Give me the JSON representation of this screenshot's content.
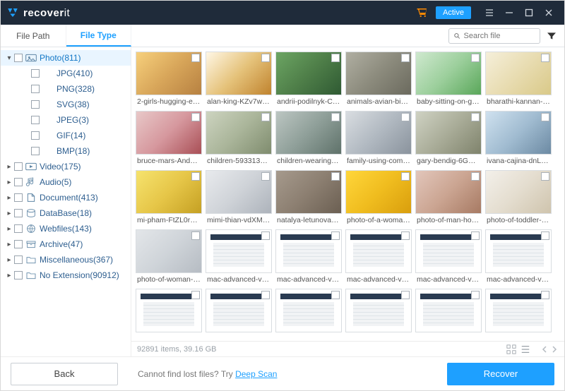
{
  "title": {
    "brand1": "recover",
    "brand2": "it",
    "active_badge": "Active"
  },
  "tabs": {
    "path": "File Path",
    "type": "File Type"
  },
  "search": {
    "placeholder": "Search file"
  },
  "tree": {
    "photo": {
      "label": "Photo(811)",
      "expanded": true,
      "children": [
        {
          "label": "JPG(410)"
        },
        {
          "label": "PNG(328)"
        },
        {
          "label": "SVG(38)"
        },
        {
          "label": "JPEG(3)"
        },
        {
          "label": "GIF(14)"
        },
        {
          "label": "BMP(18)"
        }
      ]
    },
    "others": [
      {
        "label": "Video(175)"
      },
      {
        "label": "Audio(5)"
      },
      {
        "label": "Document(413)"
      },
      {
        "label": "DataBase(18)"
      },
      {
        "label": "Webfiles(143)"
      },
      {
        "label": "Archive(47)"
      },
      {
        "label": "Miscellaneous(367)"
      },
      {
        "label": "No Extension(90912)"
      }
    ]
  },
  "thumbs": {
    "row0": [
      "2-girls-hugging-eac...",
      "alan-king-KZv7w34tl...",
      "andrii-podilnyk-CFtf...",
      "animals-avian-birds-...",
      "baby-sitting-on-gree...",
      "bharathi-kannan-rfL..."
    ],
    "row1": [
      "bruce-mars-AndE50...",
      "children-593313_19...",
      "children-wearing-pi...",
      "family-using-comput...",
      "gary-bendig-6GMq7...",
      "ivana-cajina-dnL6ZI..."
    ],
    "row2": [
      "mi-pham-FtZL0r4DZ...",
      "mimi-thian-vdXMSiX...",
      "natalya-letunova-FW...",
      "photo-of-a-woman-h...",
      "photo-of-man-holdin...",
      "photo-of-toddler-sm..."
    ],
    "row3": [
      "photo-of-woman-usi...",
      "mac-advanced-vide...",
      "mac-advanced-vide...",
      "mac-advanced-vide...",
      "mac-advanced-vide...",
      "mac-advanced-vide..."
    ],
    "row4": [
      "",
      "",
      "",
      "",
      "",
      ""
    ]
  },
  "status": {
    "summary": "92891 items, 39.16  GB"
  },
  "footer": {
    "back": "Back",
    "hint_pre": "Cannot find lost files? Try ",
    "hint_link": "Deep Scan",
    "recover": "Recover"
  }
}
